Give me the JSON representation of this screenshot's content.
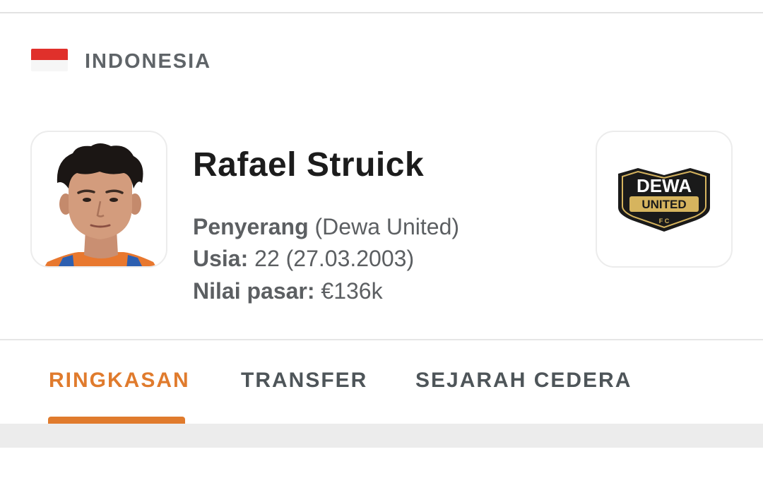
{
  "country": {
    "name": "INDONESIA",
    "flag_colors": [
      "#e0302b",
      "#f6f6f6"
    ]
  },
  "player": {
    "name": "Rafael Struick",
    "position_label": "Penyerang",
    "club_paren": "(Dewa United)",
    "age_label": "Usia:",
    "age_value": "22 (27.03.2003)",
    "value_label": "Nilai pasar:",
    "value_amount": "€136k"
  },
  "club_logo": {
    "line1": "DEWA",
    "line2": "UNITED",
    "line3": "F C"
  },
  "tabs": [
    {
      "label": "RINGKASAN",
      "active": true
    },
    {
      "label": "TRANSFER",
      "active": false
    },
    {
      "label": "SEJARAH CEDERA",
      "active": false
    }
  ],
  "colors": {
    "accent": "#e07b2d",
    "text": "#5c5f62",
    "title": "#1c1c1c"
  }
}
